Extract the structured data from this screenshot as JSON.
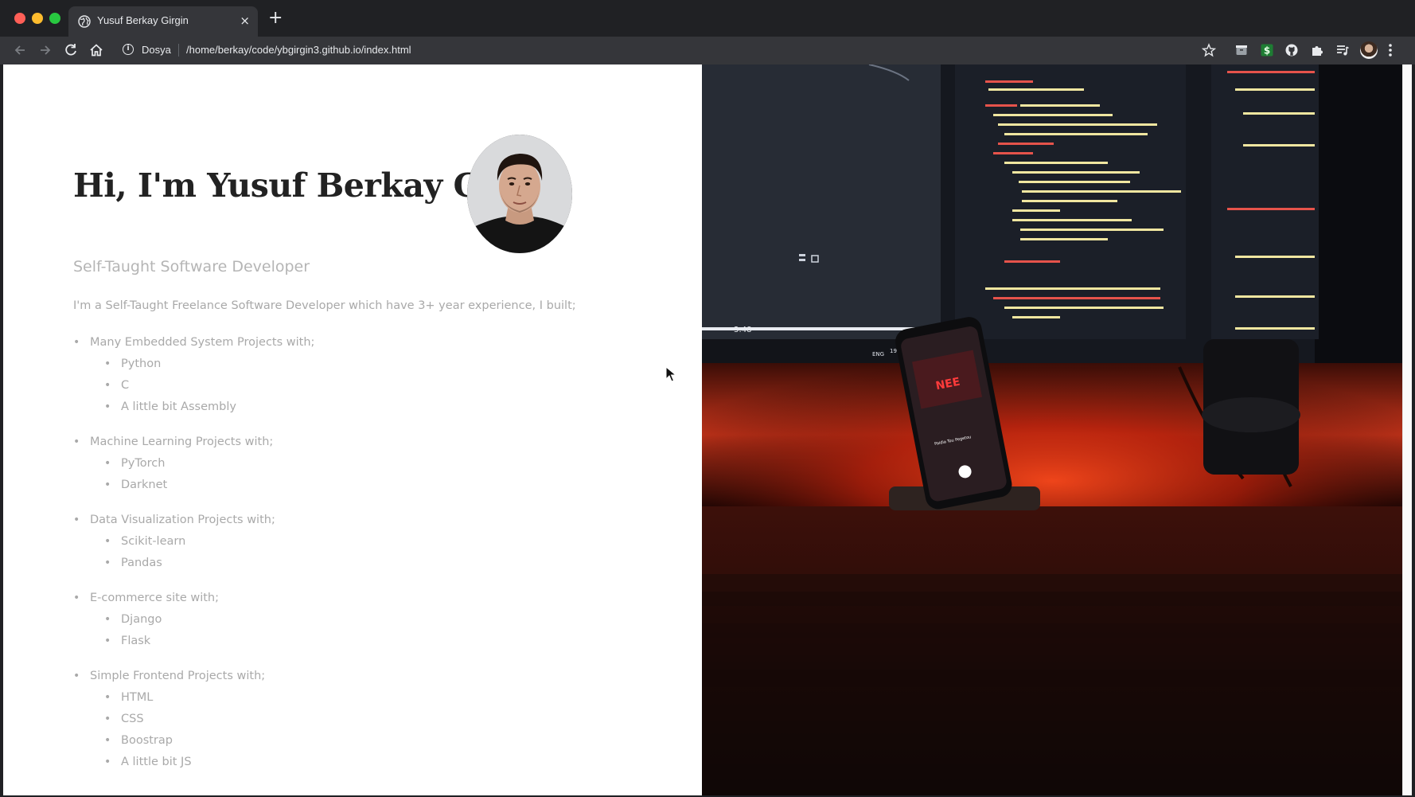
{
  "browser": {
    "tab_title": "Yusuf Berkay Girgin",
    "new_tab_symbol": "+",
    "close_symbol": "×",
    "scheme_label": "Dosya",
    "url": "/home/berkay/code/ybgirgin3.github.io/index.html"
  },
  "page": {
    "title": "Hi, I'm Yusuf Berkay Girgin",
    "subtitle": "Self-Taught Software Developer",
    "intro": "I'm a Self-Taught Freelance Software Developer which have 3+ year experience, I built;",
    "projects": [
      {
        "title": "Many Embedded System Projects with;",
        "techs": [
          "Python",
          "C",
          "A little bit Assembly"
        ]
      },
      {
        "title": "Machine Learning Projects with;",
        "techs": [
          "PyTorch",
          "Darknet"
        ]
      },
      {
        "title": "Data Visualization Projects with;",
        "techs": [
          "Scikit-learn",
          "Pandas"
        ]
      },
      {
        "title": "E-commerce site with;",
        "techs": [
          "Django",
          "Flask"
        ]
      },
      {
        "title": "Simple Frontend Projects with;",
        "techs": [
          "HTML",
          "CSS",
          "Boostrap",
          "A little bit JS"
        ]
      }
    ]
  },
  "photo": {
    "phone_band": "NEE",
    "phone_song": "Paidia Tou Pegetou",
    "monitor_time": "3:48",
    "taskbar_clock": "19:17",
    "taskbar_lang": "ENG"
  },
  "colors": {
    "accent_glow": "#ff3b14",
    "code_keyword": "#e6534b",
    "code_text": "#f0e6a0"
  }
}
